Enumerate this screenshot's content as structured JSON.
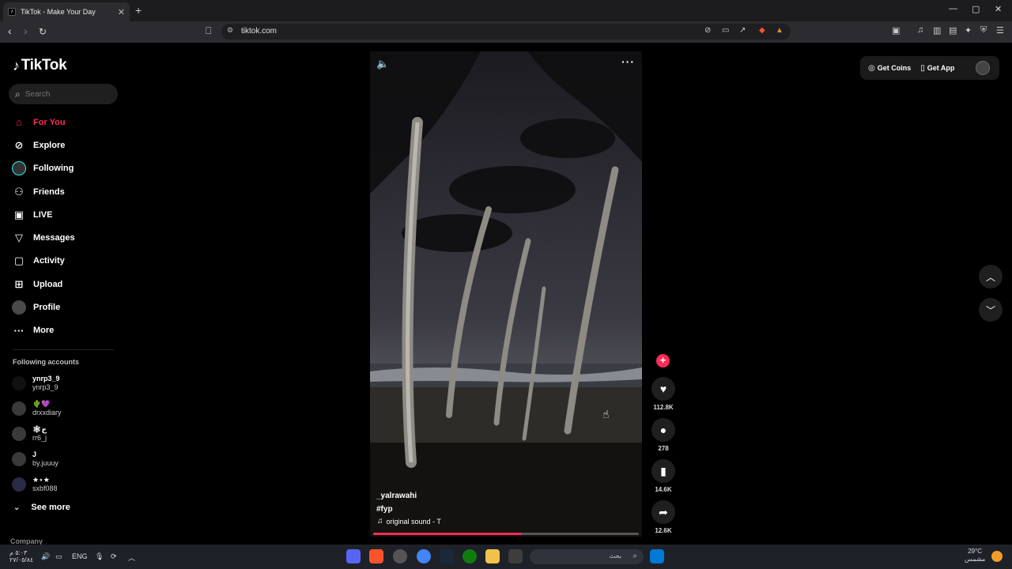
{
  "browser": {
    "tab_title": "TikTok - Make Your Day",
    "tab_favicon": "tiktok-icon",
    "url": "tiktok.com"
  },
  "sidebar": {
    "logo_text": "TikTok",
    "search_placeholder": "Search",
    "nav": [
      {
        "label": "For You",
        "icon": "home-icon",
        "active": true
      },
      {
        "label": "Explore",
        "icon": "compass-icon"
      },
      {
        "label": "Following",
        "icon": "following-avatar-icon"
      },
      {
        "label": "Friends",
        "icon": "friends-icon"
      },
      {
        "label": "LIVE",
        "icon": "live-icon"
      },
      {
        "label": "Messages",
        "icon": "messages-icon"
      },
      {
        "label": "Activity",
        "icon": "activity-icon"
      },
      {
        "label": "Upload",
        "icon": "upload-icon"
      },
      {
        "label": "Profile",
        "icon": "profile-avatar-icon"
      },
      {
        "label": "More",
        "icon": "more-dots-icon"
      }
    ],
    "following_header": "Following accounts",
    "accounts": [
      {
        "display": "ynrp3_9",
        "username": "ynrp3_9"
      },
      {
        "display": "🌵💜",
        "username": "drxxdiary"
      },
      {
        "display": "🕸ج",
        "username": "rr6_j"
      },
      {
        "display": "J",
        "username": "by.juuuy"
      },
      {
        "display": "★⋆★",
        "username": "sxbf088"
      }
    ],
    "see_more": "See more",
    "company": "Company"
  },
  "video": {
    "author": "_yalrawahi",
    "caption": "#fyp",
    "sound": "original sound - T",
    "progress": 0.56
  },
  "actions": {
    "likes": "112.8K",
    "comments": "278",
    "saves": "14.6K",
    "shares": "12.6K"
  },
  "top_right": {
    "get_coins": "Get Coins",
    "get_app": "Get App"
  },
  "taskbar": {
    "time": "٥:٠٣ م",
    "date": "٢٧/٠٥/٨٤",
    "lang": "ENG",
    "search_text": "بحث",
    "temperature": "29°C",
    "weather_text": "مشمس"
  },
  "colors": {
    "accent": "#fe2c55",
    "background": "#000000"
  }
}
